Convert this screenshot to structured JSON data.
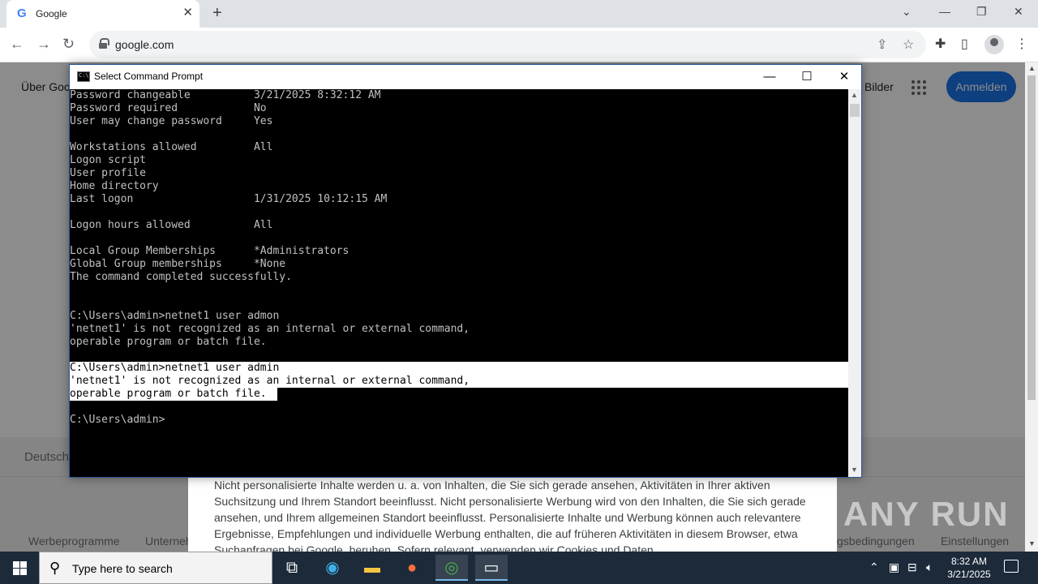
{
  "browser": {
    "tab_title": "Google",
    "tab_favicon": "G",
    "url": "google.com"
  },
  "google": {
    "about": "Über Goo",
    "images": "Bilder",
    "sign_in": "Anmelden",
    "language": "Deutsch",
    "footer_links": [
      "Werbeprogramme",
      "Unterneh",
      "gsbedingungen",
      "Einstellungen"
    ],
    "consent_text": "Nicht personalisierte Inhalte werden u. a. von Inhalten, die Sie sich gerade ansehen, Aktivitäten in Ihrer aktiven Suchsitzung und Ihrem Standort beeinflusst. Nicht personalisierte Werbung wird von den Inhalten, die Sie sich gerade ansehen, und Ihrem allgemeinen Standort beeinflusst. Personalisierte Inhalte und Werbung können auch relevantere Ergebnisse, Empfehlungen und individuelle Werbung enthalten, die auf früheren Aktivitäten in diesem Browser, etwa Suchanfragen bei Google, beruhen. Sofern relevant, verwenden wir Cookies und Daten"
  },
  "watermark": "ANY RUN",
  "cmd": {
    "title": "Select Command Prompt",
    "lines": [
      "Password changeable          3/21/2025 8:32:12 AM",
      "Password required            No",
      "User may change password     Yes",
      "",
      "Workstations allowed         All",
      "Logon script",
      "User profile",
      "Home directory",
      "Last logon                   1/31/2025 10:12:15 AM",
      "",
      "Logon hours allowed          All",
      "",
      "Local Group Memberships      *Administrators",
      "Global Group memberships     *None",
      "The command completed successfully.",
      "",
      "",
      "C:\\Users\\admin>netnet1 user admon",
      "'netnet1' is not recognized as an internal or external command,",
      "operable program or batch file.",
      "",
      "C:\\Users\\admin>netnet1 user admin",
      "'netnet1' is not recognized as an internal or external command,",
      "operable program or batch file.",
      "",
      "C:\\Users\\admin>"
    ]
  },
  "taskbar": {
    "search_placeholder": "Type here to search",
    "time": "8:32 AM",
    "date": "3/21/2025"
  },
  "colors": {
    "cmd_bg": "#000000",
    "cmd_text": "#c0c0c0",
    "selection_bg": "#ffffff",
    "google_blue": "#1a73e8",
    "taskbar_bg": "#1c2a3a"
  }
}
